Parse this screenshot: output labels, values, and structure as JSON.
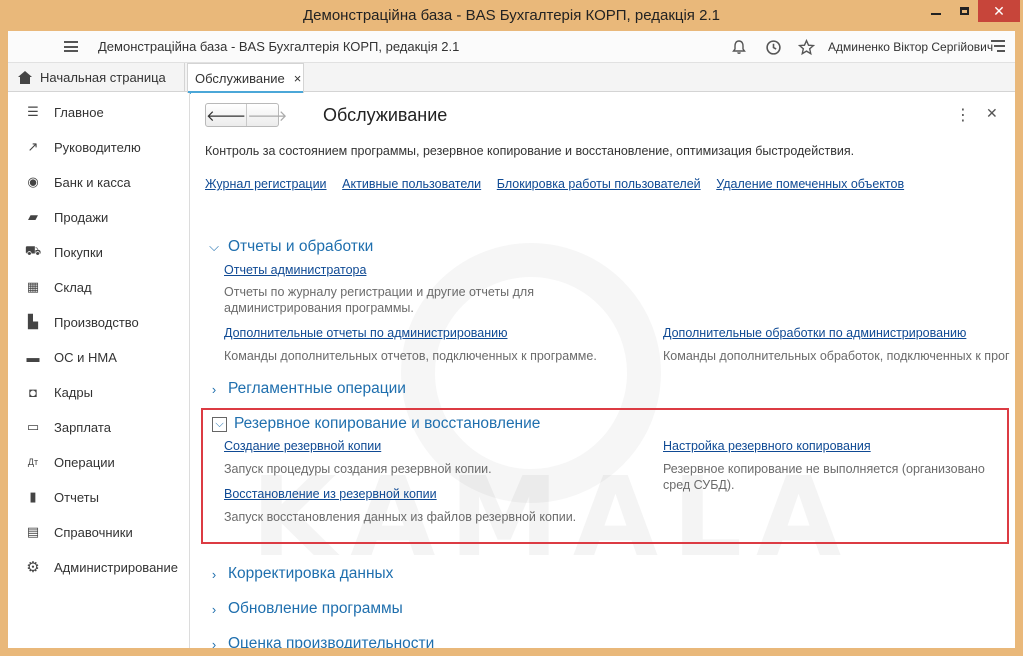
{
  "window": {
    "title": "Демонстраційна база - BAS Бухгалтерія КОРП, редакція 2.1",
    "close_glyph": "✕"
  },
  "appbar": {
    "title": "Демонстраційна база - BAS Бухгалтерія КОРП, редакція 2.1",
    "user": "Админенко Віктор Сергійович"
  },
  "tabs": {
    "home_label": "Начальная страница",
    "active_label": "Обслуживание",
    "close_glyph": "×"
  },
  "sidebar": {
    "items": [
      {
        "label": "Главное",
        "icon": "list-icon",
        "glyph": "☰"
      },
      {
        "label": "Руководителю",
        "icon": "trend-icon",
        "glyph": "↗"
      },
      {
        "label": "Банк и касса",
        "icon": "coin-icon",
        "glyph": "◉"
      },
      {
        "label": "Продажи",
        "icon": "bag-icon",
        "glyph": "▰"
      },
      {
        "label": "Покупки",
        "icon": "cart-icon",
        "glyph": "⛟"
      },
      {
        "label": "Склад",
        "icon": "warehouse-icon",
        "glyph": "▦"
      },
      {
        "label": "Производство",
        "icon": "factory-icon",
        "glyph": "▙"
      },
      {
        "label": "ОС и НМА",
        "icon": "truck-icon",
        "glyph": "▬"
      },
      {
        "label": "Кадры",
        "icon": "person-icon",
        "glyph": "◘"
      },
      {
        "label": "Зарплата",
        "icon": "card-icon",
        "glyph": "▭"
      },
      {
        "label": "Операции",
        "icon": "operations-icon",
        "glyph": "Дт"
      },
      {
        "label": "Отчеты",
        "icon": "chart-icon",
        "glyph": "▮"
      },
      {
        "label": "Справочники",
        "icon": "book-icon",
        "glyph": "▤"
      },
      {
        "label": "Администрирование",
        "icon": "gear-icon",
        "glyph": "⚙"
      }
    ]
  },
  "main": {
    "title": "Обслуживание",
    "description": "Контроль за состоянием программы, резервное копирование и восстановление, оптимизация быстродействия.",
    "top_links": [
      "Журнал регистрации",
      "Активные пользователи",
      "Блокировка работы пользователей",
      "Удаление помеченных объектов"
    ],
    "sections": {
      "reports": {
        "title": "Отчеты и обработки",
        "admin_reports_link": "Отчеты администратора",
        "admin_reports_note": "Отчеты по журналу регистрации и другие отчеты для администрирования программы.",
        "extra_reports_link": "Дополнительные отчеты по администрированию",
        "extra_reports_note": "Команды дополнительных отчетов, подключенных к программе.",
        "extra_processing_link": "Дополнительные обработки по администрированию",
        "extra_processing_note": "Команды дополнительных обработок, подключенных к прог"
      },
      "routine": {
        "title": "Регламентные операции"
      },
      "backup": {
        "title": "Резервное копирование и восстановление",
        "create_link": "Создание резервной копии",
        "create_note": "Запуск процедуры создания резервной копии.",
        "settings_link": "Настройка резервного копирования",
        "settings_note": "Резервное копирование не выполняется (организовано сред СУБД).",
        "restore_link": "Восстановление из резервной копии",
        "restore_note": "Запуск восстановления данных из файлов резервной копии."
      },
      "correction": {
        "title": "Корректировка данных"
      },
      "update": {
        "title": "Обновление программы"
      },
      "performance": {
        "title": "Оценка производительности"
      }
    }
  },
  "watermark": "KAMALA",
  "colors": {
    "accent": "#1f6fae",
    "link": "#0f4a94",
    "highlight": "#dc3b43",
    "titlebar": "#e9b87a"
  }
}
